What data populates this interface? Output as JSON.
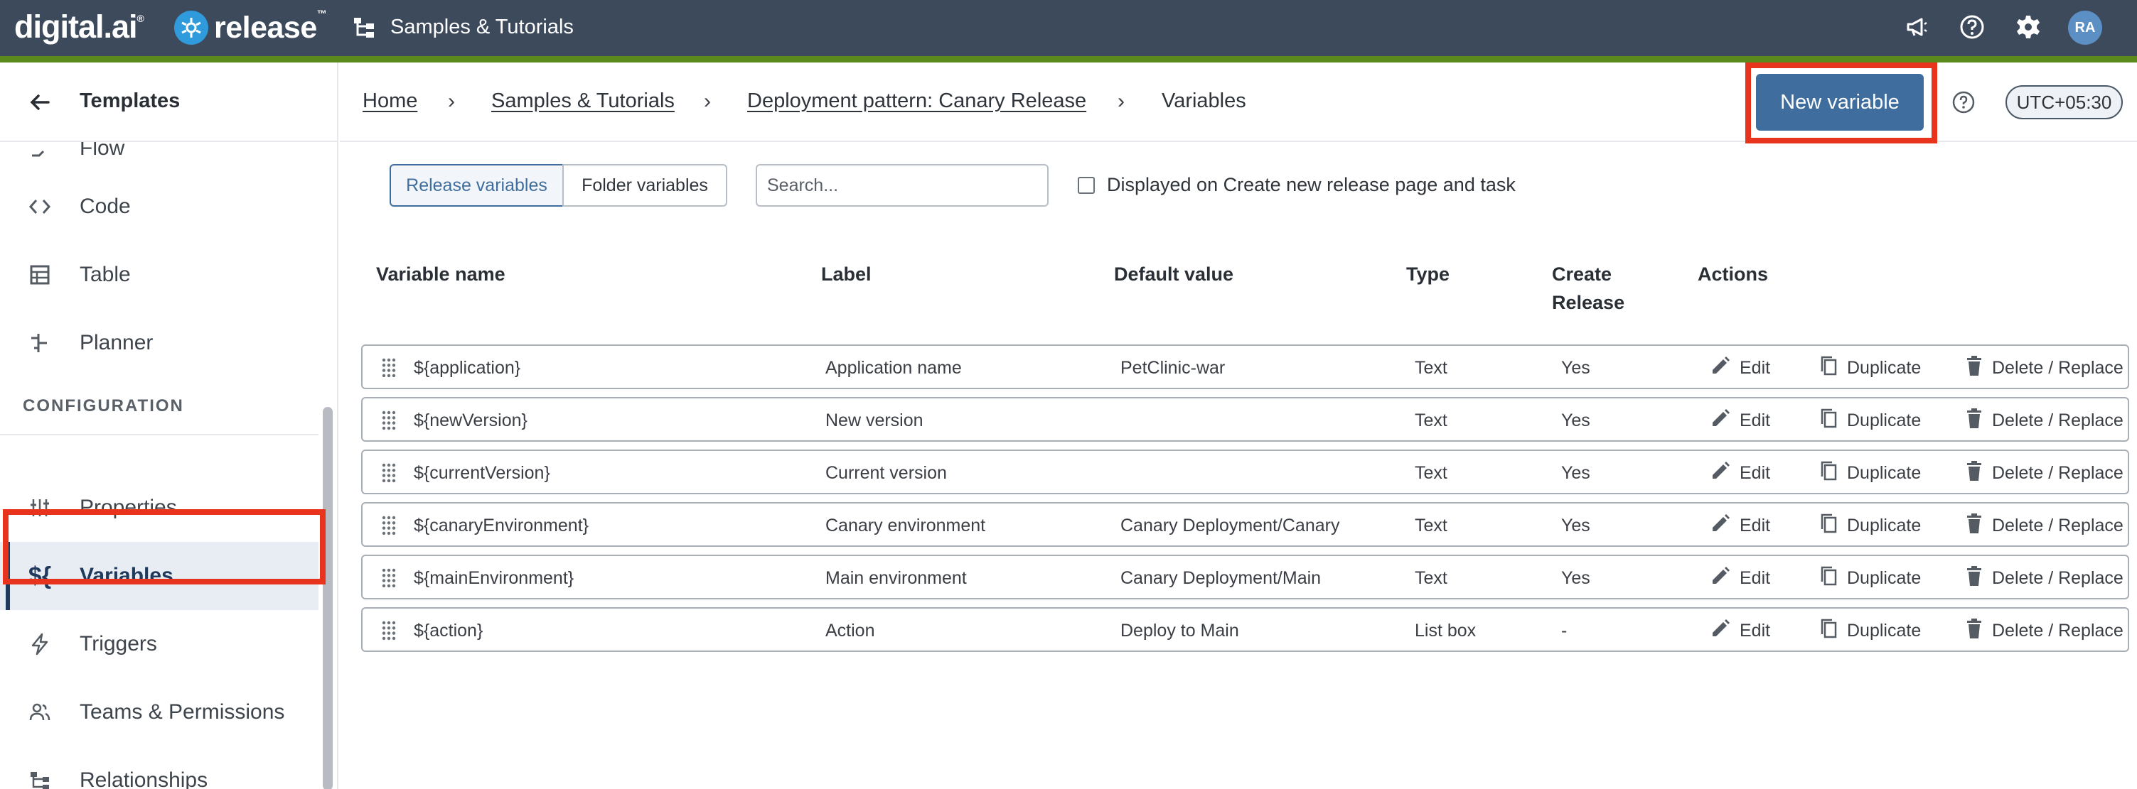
{
  "topbar": {
    "brand_digital": "digital.ai",
    "brand_release": "release",
    "folder_title": "Samples & Tutorials",
    "avatar_initials": "RA",
    "icons": [
      "megaphone-icon",
      "help-icon",
      "gear-icon"
    ]
  },
  "sidebar": {
    "title": "Templates",
    "partial_item": "Flow",
    "items_top": [
      {
        "label": "Code",
        "icon": "code-icon"
      },
      {
        "label": "Table",
        "icon": "table-icon"
      },
      {
        "label": "Planner",
        "icon": "planner-icon"
      }
    ],
    "section_title": "CONFIGURATION",
    "items_config": [
      {
        "label": "Properties",
        "icon": "sliders-icon"
      },
      {
        "label": "Variables",
        "icon": "variables-icon",
        "glyph": "${",
        "active": true
      },
      {
        "label": "Triggers",
        "icon": "lightning-icon"
      },
      {
        "label": "Teams & Permissions",
        "icon": "people-icon"
      },
      {
        "label": "Relationships",
        "icon": "relationships-icon"
      }
    ]
  },
  "breadcrumb": {
    "items": [
      "Home",
      "Samples & Tutorials",
      "Deployment pattern: Canary Release",
      "Variables"
    ]
  },
  "header": {
    "new_variable_label": "New variable",
    "timezone": "UTC+05:30"
  },
  "filters": {
    "release_tab": "Release variables",
    "folder_tab": "Folder variables",
    "search_placeholder": "Search...",
    "checkbox_label": "Displayed on Create new release page and task"
  },
  "table": {
    "headers": {
      "name": "Variable name",
      "label": "Label",
      "default": "Default value",
      "type": "Type",
      "create_release_1": "Create",
      "create_release_2": "Release",
      "actions": "Actions"
    },
    "action_labels": {
      "edit": "Edit",
      "duplicate": "Duplicate",
      "delete": "Delete / Replace"
    },
    "rows": [
      {
        "name": "${application}",
        "label": "Application name",
        "default": "PetClinic-war",
        "type": "Text",
        "create": "Yes"
      },
      {
        "name": "${newVersion}",
        "label": "New version",
        "default": "",
        "type": "Text",
        "create": "Yes"
      },
      {
        "name": "${currentVersion}",
        "label": "Current version",
        "default": "",
        "type": "Text",
        "create": "Yes"
      },
      {
        "name": "${canaryEnvironment}",
        "label": "Canary environment",
        "default": "Canary Deployment/Canary",
        "type": "Text",
        "create": "Yes"
      },
      {
        "name": "${mainEnvironment}",
        "label": "Main environment",
        "default": "Canary Deployment/Main",
        "type": "Text",
        "create": "Yes"
      },
      {
        "name": "${action}",
        "label": "Action",
        "default": "Deploy to Main",
        "type": "List box",
        "create": "-"
      }
    ]
  },
  "colors": {
    "topbar": "#3d4a5c",
    "accent_green": "#5b8a1c",
    "primary_button": "#3f6e9e",
    "highlight_red": "#e8341c"
  }
}
